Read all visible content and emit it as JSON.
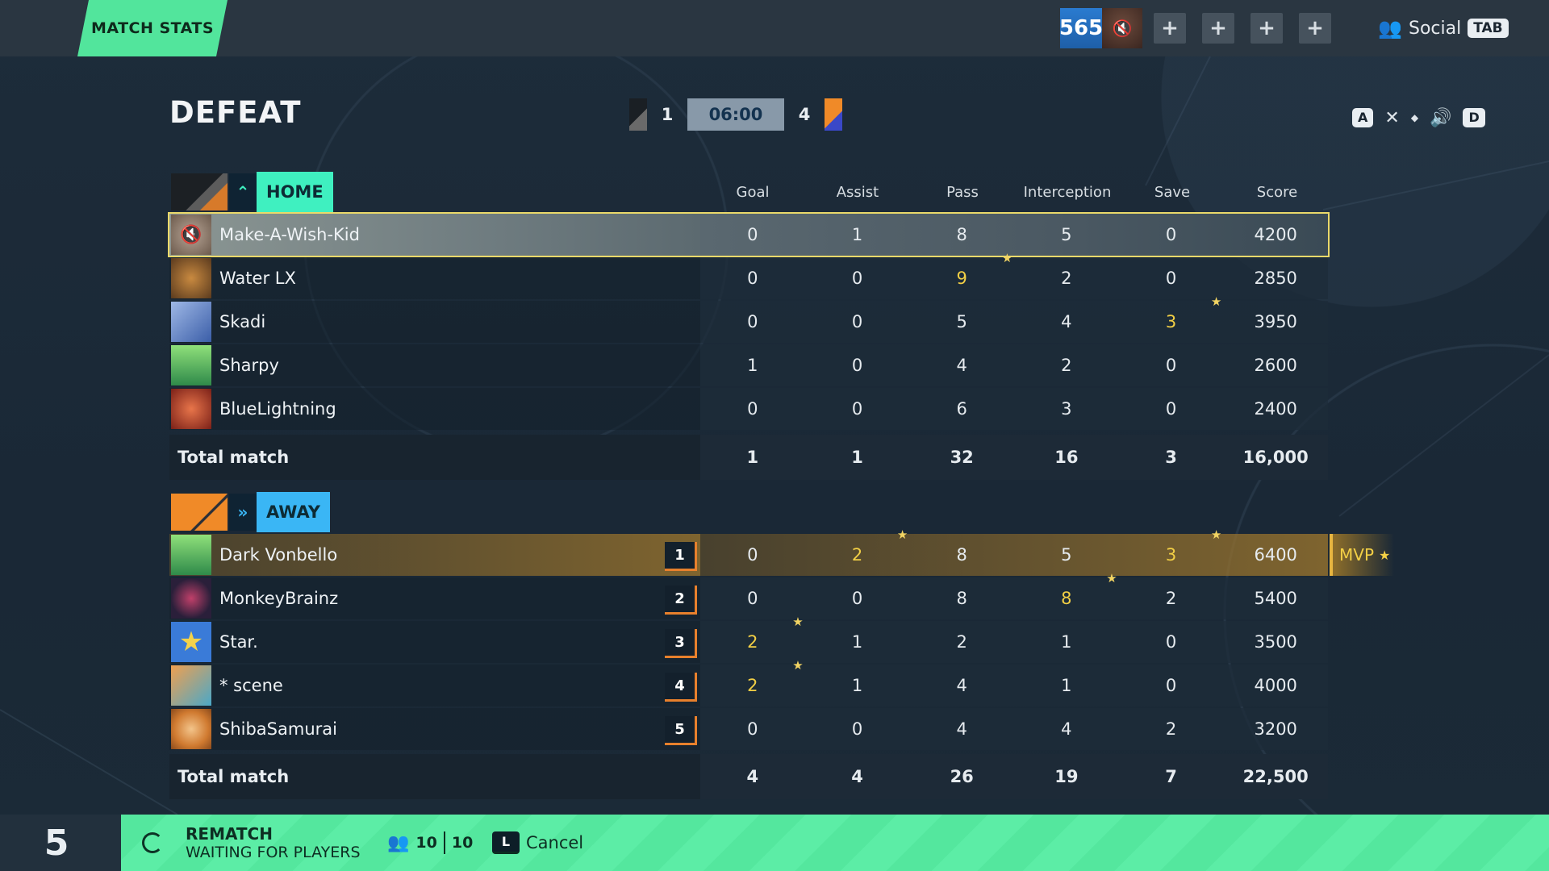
{
  "topbar": {
    "tab_label": "MATCH STATS",
    "level": "565",
    "plus_buttons": [
      "+",
      "+",
      "+",
      "+"
    ],
    "social_label": "Social",
    "social_key": "TAB"
  },
  "result": {
    "title": "DEFEAT",
    "home_score": "1",
    "timer": "06:00",
    "away_score": "4"
  },
  "audio": {
    "key_left": "A",
    "key_right": "D"
  },
  "columns": [
    "Goal",
    "Assist",
    "Pass",
    "Interception",
    "Save",
    "Score"
  ],
  "home": {
    "label": "HOME",
    "accent": "#3ff0c0",
    "players": [
      {
        "name": "Make-A-Wish-Kid",
        "stats": [
          "0",
          "1",
          "8",
          "5",
          "0",
          "4200"
        ],
        "self": true
      },
      {
        "name": "Water LX",
        "stats": [
          "0",
          "0",
          "9",
          "2",
          "0",
          "2850"
        ]
      },
      {
        "name": "Skadi",
        "stats": [
          "0",
          "0",
          "5",
          "4",
          "3",
          "3950"
        ]
      },
      {
        "name": "Sharpy",
        "stats": [
          "1",
          "0",
          "4",
          "2",
          "0",
          "2600"
        ]
      },
      {
        "name": "BlueLightning",
        "stats": [
          "0",
          "0",
          "6",
          "3",
          "0",
          "2400"
        ]
      }
    ],
    "total": {
      "label": "Total match",
      "stats": [
        "1",
        "1",
        "32",
        "16",
        "3",
        "16,000"
      ]
    }
  },
  "away": {
    "label": "AWAY",
    "accent": "#3ab6f5",
    "players": [
      {
        "name": "Dark Vonbello",
        "rank": "1",
        "stats": [
          "0",
          "2",
          "8",
          "5",
          "3",
          "6400"
        ],
        "mvp": true
      },
      {
        "name": "MonkeyBrainz",
        "rank": "2",
        "stats": [
          "0",
          "0",
          "8",
          "8",
          "2",
          "5400"
        ]
      },
      {
        "name": "Star.",
        "rank": "3",
        "stats": [
          "2",
          "1",
          "2",
          "1",
          "0",
          "3500"
        ]
      },
      {
        "name": "* scene",
        "rank": "4",
        "stats": [
          "2",
          "1",
          "4",
          "1",
          "0",
          "4000"
        ]
      },
      {
        "name": "ShibaSamurai",
        "rank": "5",
        "stats": [
          "0",
          "0",
          "4",
          "4",
          "2",
          "3200"
        ]
      }
    ],
    "total": {
      "label": "Total match",
      "stats": [
        "4",
        "4",
        "26",
        "19",
        "7",
        "22,500"
      ]
    }
  },
  "mvp_label": "MVP",
  "bottom": {
    "countdown": "5",
    "rematch_title": "REMATCH",
    "rematch_sub": "WAITING FOR PLAYERS",
    "players_ready": "10",
    "players_total": "10",
    "cancel_key": "L",
    "cancel_label": "Cancel"
  }
}
